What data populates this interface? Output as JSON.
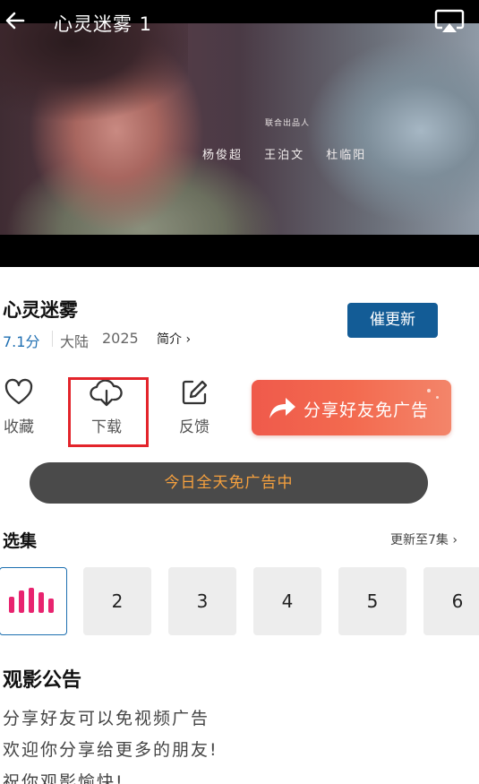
{
  "player": {
    "title": "心灵迷雾 1",
    "credits_heading": "联合出品人",
    "credits_names": "杨俊超 王泊文 杜临阳"
  },
  "show": {
    "title": "心灵迷雾",
    "rating": "7.1分",
    "region": "大陆",
    "year": "2025",
    "intro_label": "简介 ›",
    "update_button": "催更新"
  },
  "actions": {
    "favorite": "收藏",
    "download": "下载",
    "feedback": "反馈",
    "share": "分享好友免广告"
  },
  "ad_free_banner": "今日全天免广告中",
  "episodes": {
    "heading": "选集",
    "more_label": "更新至7集 ›",
    "items": [
      "1",
      "2",
      "3",
      "4",
      "5",
      "6"
    ]
  },
  "notice": {
    "title": "观影公告",
    "lines": [
      "分享好友可以免视频广告",
      "欢迎你分享给更多的朋友!",
      "祝你观影愉快!"
    ]
  },
  "colors": {
    "accent_blue": "#135c96",
    "rating_blue": "#1f6fb2",
    "share_gradient_start": "#ef5a4b",
    "ad_free_text": "#f7a13e",
    "highlight_red": "#e3242b",
    "playing_bars": "#e8246f"
  },
  "icons": [
    "back-arrow-icon",
    "airplay-icon",
    "heart-icon",
    "cloud-download-icon",
    "edit-icon",
    "share-arrow-icon",
    "equalizer-icon"
  ]
}
